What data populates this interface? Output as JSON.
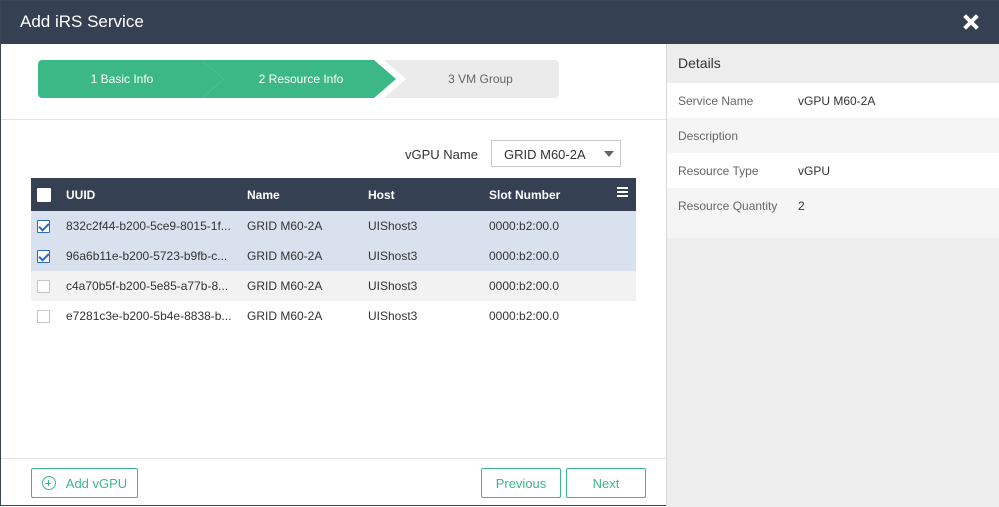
{
  "dialog": {
    "title": "Add iRS Service"
  },
  "steps": [
    {
      "label": "1 Basic Info",
      "state": "done"
    },
    {
      "label": "2 Resource Info",
      "state": "active"
    },
    {
      "label": "3 VM Group",
      "state": "pending"
    }
  ],
  "filter": {
    "label": "vGPU Name",
    "selected": "GRID M60-2A"
  },
  "table": {
    "columns": [
      "UUID",
      "Name",
      "Host",
      "Slot Number"
    ],
    "rows": [
      {
        "checked": true,
        "uuid": "832c2f44-b200-5ce9-8015-1f...",
        "name": "GRID M60-2A",
        "host": "UIShost3",
        "slot": "0000:b2:00.0"
      },
      {
        "checked": true,
        "uuid": "96a6b11e-b200-5723-b9fb-c...",
        "name": "GRID M60-2A",
        "host": "UIShost3",
        "slot": "0000:b2:00.0"
      },
      {
        "checked": false,
        "uuid": "c4a70b5f-b200-5e85-a77b-8...",
        "name": "GRID M60-2A",
        "host": "UIShost3",
        "slot": "0000:b2:00.0"
      },
      {
        "checked": false,
        "uuid": "e7281c3e-b200-5b4e-8838-b...",
        "name": "GRID M60-2A",
        "host": "UIShost3",
        "slot": "0000:b2:00.0"
      }
    ]
  },
  "buttons": {
    "add": "Add vGPU",
    "previous": "Previous",
    "next": "Next"
  },
  "details": {
    "title": "Details",
    "rows": [
      {
        "label": "Service Name",
        "value": "vGPU M60-2A"
      },
      {
        "label": "Description",
        "value": ""
      },
      {
        "label": "Resource Type",
        "value": "vGPU"
      },
      {
        "label": "Resource Quantity",
        "value": "2"
      }
    ]
  },
  "colors": {
    "header": "#354052",
    "accent": "#3cb887",
    "selected_row": "#dae1ee"
  }
}
